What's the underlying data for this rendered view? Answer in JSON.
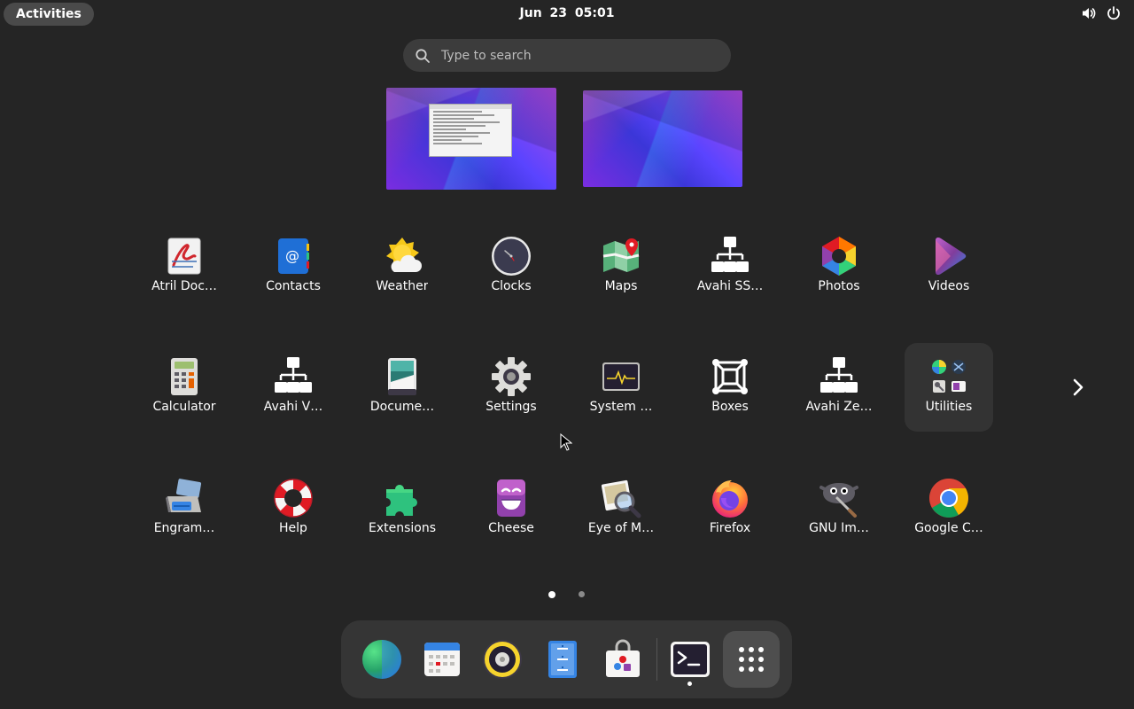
{
  "topbar": {
    "activities_label": "Activities",
    "clock": "Jun 23  05:01",
    "tray_icons": [
      "volume-icon",
      "power-icon"
    ]
  },
  "search": {
    "placeholder": "Type to search"
  },
  "workspaces": [
    {
      "name": "workspace-1",
      "has_window": true
    },
    {
      "name": "workspace-2",
      "has_window": false
    }
  ],
  "apps": {
    "row1": [
      {
        "label": "Atril Doc…",
        "icon": "atril-icon"
      },
      {
        "label": "Contacts",
        "icon": "contacts-icon"
      },
      {
        "label": "Weather",
        "icon": "weather-icon"
      },
      {
        "label": "Clocks",
        "icon": "clocks-icon"
      },
      {
        "label": "Maps",
        "icon": "maps-icon"
      },
      {
        "label": "Avahi SS…",
        "icon": "network-icon"
      },
      {
        "label": "Photos",
        "icon": "photos-icon"
      },
      {
        "label": "Videos",
        "icon": "videos-icon"
      }
    ],
    "row2": [
      {
        "label": "Calculator",
        "icon": "calculator-icon"
      },
      {
        "label": "Avahi V…",
        "icon": "network-icon"
      },
      {
        "label": "Docume…",
        "icon": "document-scanner-icon"
      },
      {
        "label": "Settings",
        "icon": "gear-icon"
      },
      {
        "label": "System …",
        "icon": "system-monitor-icon"
      },
      {
        "label": "Boxes",
        "icon": "boxes-icon"
      },
      {
        "label": "Avahi Ze…",
        "icon": "network-icon"
      },
      {
        "label": "Utilities",
        "icon": "folder-utilities-icon"
      }
    ],
    "row3": [
      {
        "label": "Engram…",
        "icon": "engrampa-icon"
      },
      {
        "label": "Help",
        "icon": "lifebuoy-icon"
      },
      {
        "label": "Extensions",
        "icon": "puzzle-icon"
      },
      {
        "label": "Cheese",
        "icon": "cheese-icon"
      },
      {
        "label": "Eye of M…",
        "icon": "image-viewer-icon"
      },
      {
        "label": "Firefox",
        "icon": "firefox-icon"
      },
      {
        "label": "GNU Im…",
        "icon": "gimp-icon"
      },
      {
        "label": "Google C…",
        "icon": "chrome-icon"
      }
    ]
  },
  "pages": {
    "count": 2,
    "current": 1
  },
  "dash": [
    {
      "name": "web-browser",
      "icon": "globe-icon"
    },
    {
      "name": "calendar",
      "icon": "calendar-icon"
    },
    {
      "name": "music",
      "icon": "speaker-icon"
    },
    {
      "name": "text-editor",
      "icon": "text-editor-icon"
    },
    {
      "name": "software",
      "icon": "software-bag-icon"
    },
    {
      "name": "terminal",
      "icon": "terminal-icon",
      "running": true
    },
    {
      "name": "show-apps",
      "icon": "app-grid-icon"
    }
  ],
  "colors": {
    "background": "#252525",
    "pill": "#4a4a4a",
    "search_bg": "#3c3c3c",
    "dash_bg": "#353535",
    "highlight": "#333333",
    "dot_active": "#ffffff",
    "dot_inactive": "#8a8a8a"
  }
}
